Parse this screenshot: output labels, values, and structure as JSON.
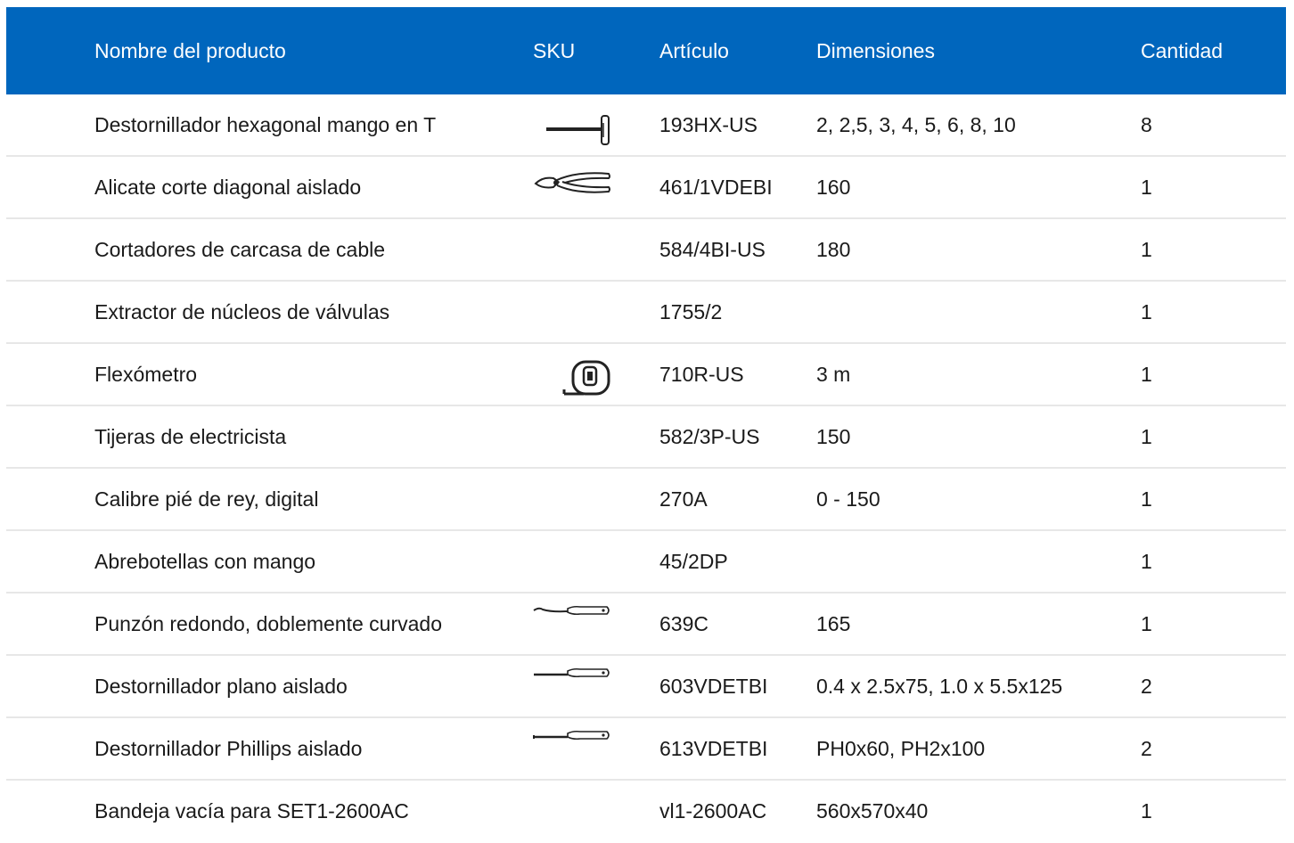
{
  "header": {
    "name": "Nombre del producto",
    "sku": "SKU",
    "article": "Artículo",
    "dimensions": "Dimensiones",
    "quantity": "Cantidad"
  },
  "accent_color": "#0066bd",
  "rows": [
    {
      "name": "Destornillador hexagonal mango en T",
      "icon": "t-handle-hex-key-icon",
      "article": "193HX-US",
      "dimensions": "2, 2,5, 3, 4, 5, 6, 8, 10",
      "quantity": "8"
    },
    {
      "name": "Alicate corte diagonal aislado",
      "icon": "diagonal-cutter-pliers-icon",
      "article": "461/1VDEBI",
      "dimensions": "160",
      "quantity": "1"
    },
    {
      "name": "Cortadores de carcasa de cable",
      "icon": "",
      "article": "584/4BI-US",
      "dimensions": "180",
      "quantity": "1"
    },
    {
      "name": "Extractor de núcleos de válvulas",
      "icon": "",
      "article": "1755/2",
      "dimensions": "",
      "quantity": "1"
    },
    {
      "name": "Flexómetro",
      "icon": "tape-measure-icon",
      "article": "710R-US",
      "dimensions": "3 m",
      "quantity": "1"
    },
    {
      "name": "Tijeras de electricista",
      "icon": "",
      "article": "582/3P-US",
      "dimensions": "150",
      "quantity": "1"
    },
    {
      "name": "Calibre pié de rey, digital",
      "icon": "",
      "article": "270A",
      "dimensions": "0 - 150",
      "quantity": "1"
    },
    {
      "name": "Abrebotellas con mango",
      "icon": "",
      "article": "45/2DP",
      "dimensions": "",
      "quantity": "1"
    },
    {
      "name": "Punzón redondo, doblemente curvado",
      "icon": "curved-awl-icon",
      "article": "639C",
      "dimensions": "165",
      "quantity": "1"
    },
    {
      "name": "Destornillador plano aislado",
      "icon": "flat-screwdriver-icon",
      "article": "603VDETBI",
      "dimensions": "0.4 x 2.5x75, 1.0 x 5.5x125",
      "quantity": "2"
    },
    {
      "name": "Destornillador Phillips aislado",
      "icon": "phillips-screwdriver-icon",
      "article": "613VDETBI",
      "dimensions": "PH0x60, PH2x100",
      "quantity": "2"
    },
    {
      "name": "Bandeja vacía para SET1-2600AC",
      "icon": "",
      "article": "vl1-2600AC",
      "dimensions": "560x570x40",
      "quantity": "1"
    }
  ]
}
